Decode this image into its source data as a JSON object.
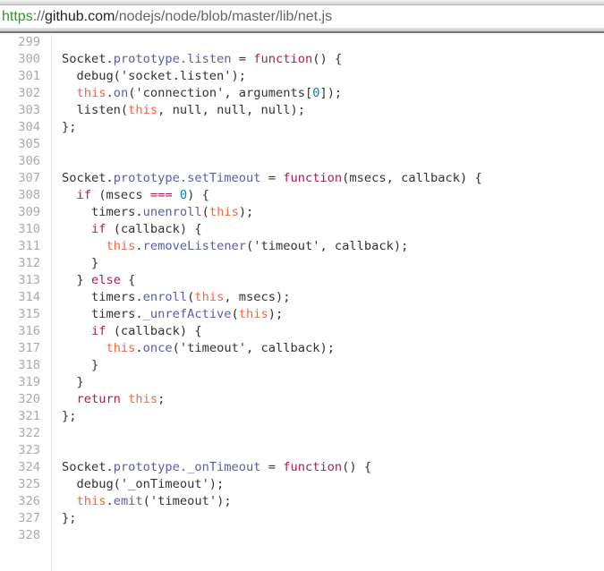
{
  "address_bar": {
    "scheme": "https",
    "sep": "://",
    "host": "github.com",
    "path": "/nodejs/node/blob/master/lib/net.js"
  },
  "colors": {
    "keyword": "#a71d5d",
    "property": "#5b5ea6",
    "this": "#ed6a43",
    "number": "#0086b3"
  },
  "lines": [
    {
      "n": "299",
      "t": []
    },
    {
      "n": "300",
      "t": [
        [
          "p",
          "Socket."
        ],
        [
          "pr",
          "prototype.listen"
        ],
        [
          "p",
          " = "
        ],
        [
          "kw",
          "function"
        ],
        [
          "p",
          "() {"
        ]
      ]
    },
    {
      "n": "301",
      "t": [
        [
          "p",
          "  debug('socket.listen');"
        ]
      ]
    },
    {
      "n": "302",
      "t": [
        [
          "p",
          "  "
        ],
        [
          "th",
          "this"
        ],
        [
          "p",
          "."
        ],
        [
          "pr",
          "on"
        ],
        [
          "p",
          "('connection', arguments["
        ],
        [
          "nm",
          "0"
        ],
        [
          "p",
          "]);"
        ]
      ]
    },
    {
      "n": "303",
      "t": [
        [
          "p",
          "  listen("
        ],
        [
          "th",
          "this"
        ],
        [
          "p",
          ", null, null, null);"
        ]
      ]
    },
    {
      "n": "304",
      "t": [
        [
          "p",
          "};"
        ]
      ]
    },
    {
      "n": "305",
      "t": []
    },
    {
      "n": "306",
      "t": []
    },
    {
      "n": "307",
      "t": [
        [
          "p",
          "Socket."
        ],
        [
          "pr",
          "prototype.setTimeout"
        ],
        [
          "p",
          " = "
        ],
        [
          "kw",
          "function"
        ],
        [
          "p",
          "(msecs, callback) {"
        ]
      ]
    },
    {
      "n": "308",
      "t": [
        [
          "p",
          "  "
        ],
        [
          "kw",
          "if"
        ],
        [
          "p",
          " (msecs "
        ],
        [
          "kw",
          "==="
        ],
        [
          "p",
          " "
        ],
        [
          "nm",
          "0"
        ],
        [
          "p",
          ") {"
        ]
      ]
    },
    {
      "n": "309",
      "t": [
        [
          "p",
          "    timers."
        ],
        [
          "pr",
          "unenroll"
        ],
        [
          "p",
          "("
        ],
        [
          "th",
          "this"
        ],
        [
          "p",
          ");"
        ]
      ]
    },
    {
      "n": "310",
      "t": [
        [
          "p",
          "    "
        ],
        [
          "kw",
          "if"
        ],
        [
          "p",
          " (callback) {"
        ]
      ]
    },
    {
      "n": "311",
      "t": [
        [
          "p",
          "      "
        ],
        [
          "th",
          "this"
        ],
        [
          "p",
          "."
        ],
        [
          "pr",
          "removeListener"
        ],
        [
          "p",
          "('timeout', callback);"
        ]
      ]
    },
    {
      "n": "312",
      "t": [
        [
          "p",
          "    }"
        ]
      ]
    },
    {
      "n": "313",
      "t": [
        [
          "p",
          "  } "
        ],
        [
          "kw",
          "else"
        ],
        [
          "p",
          " {"
        ]
      ]
    },
    {
      "n": "314",
      "t": [
        [
          "p",
          "    timers."
        ],
        [
          "pr",
          "enroll"
        ],
        [
          "p",
          "("
        ],
        [
          "th",
          "this"
        ],
        [
          "p",
          ", msecs);"
        ]
      ]
    },
    {
      "n": "315",
      "t": [
        [
          "p",
          "    timers."
        ],
        [
          "pr",
          "_unrefActive"
        ],
        [
          "p",
          "("
        ],
        [
          "th",
          "this"
        ],
        [
          "p",
          ");"
        ]
      ]
    },
    {
      "n": "316",
      "t": [
        [
          "p",
          "    "
        ],
        [
          "kw",
          "if"
        ],
        [
          "p",
          " (callback) {"
        ]
      ]
    },
    {
      "n": "317",
      "t": [
        [
          "p",
          "      "
        ],
        [
          "th",
          "this"
        ],
        [
          "p",
          "."
        ],
        [
          "pr",
          "once"
        ],
        [
          "p",
          "('timeout', callback);"
        ]
      ]
    },
    {
      "n": "318",
      "t": [
        [
          "p",
          "    }"
        ]
      ]
    },
    {
      "n": "319",
      "t": [
        [
          "p",
          "  }"
        ]
      ]
    },
    {
      "n": "320",
      "t": [
        [
          "p",
          "  "
        ],
        [
          "kw",
          "return"
        ],
        [
          "p",
          " "
        ],
        [
          "th",
          "this"
        ],
        [
          "p",
          ";"
        ]
      ]
    },
    {
      "n": "321",
      "t": [
        [
          "p",
          "};"
        ]
      ]
    },
    {
      "n": "322",
      "t": []
    },
    {
      "n": "323",
      "t": []
    },
    {
      "n": "324",
      "t": [
        [
          "p",
          "Socket."
        ],
        [
          "pr",
          "prototype._onTimeout"
        ],
        [
          "p",
          " = "
        ],
        [
          "kw",
          "function"
        ],
        [
          "p",
          "() {"
        ]
      ]
    },
    {
      "n": "325",
      "t": [
        [
          "p",
          "  debug('_onTimeout');"
        ]
      ]
    },
    {
      "n": "326",
      "t": [
        [
          "p",
          "  "
        ],
        [
          "th",
          "this"
        ],
        [
          "p",
          "."
        ],
        [
          "pr",
          "emit"
        ],
        [
          "p",
          "('timeout');"
        ]
      ]
    },
    {
      "n": "327",
      "t": [
        [
          "p",
          "};"
        ]
      ]
    },
    {
      "n": "328",
      "t": []
    }
  ]
}
